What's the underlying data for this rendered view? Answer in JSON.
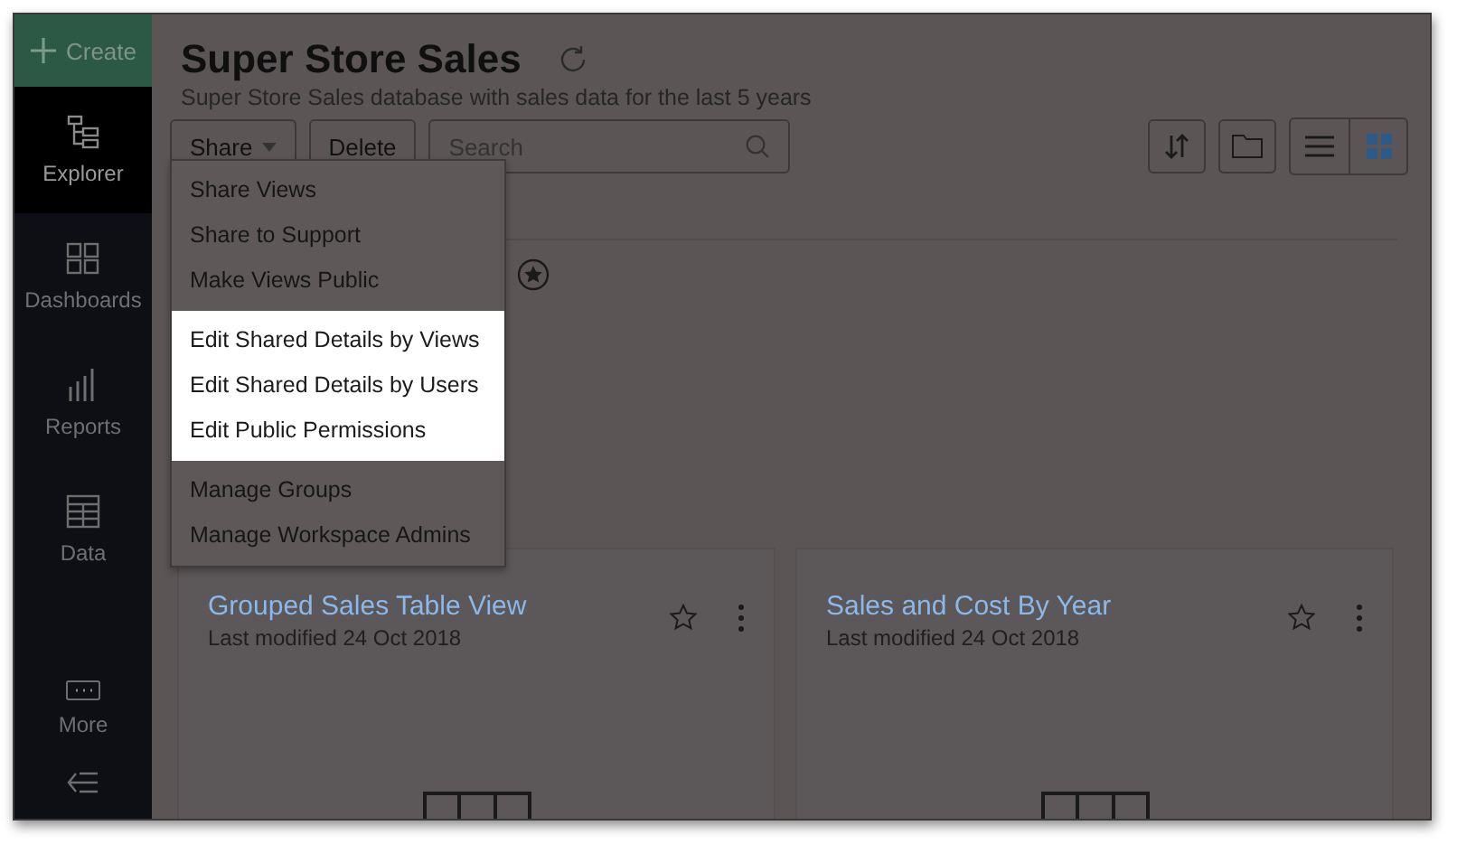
{
  "sidebar": {
    "create_label": "Create",
    "items": [
      {
        "label": "Explorer",
        "selected": true
      },
      {
        "label": "Dashboards",
        "selected": false
      },
      {
        "label": "Reports",
        "selected": false
      },
      {
        "label": "Data",
        "selected": false
      },
      {
        "label": "More",
        "selected": false
      }
    ]
  },
  "header": {
    "title": "Super Store Sales",
    "subtitle": "Super Store Sales database with sales data for the last 5 years"
  },
  "toolbar": {
    "share_label": "Share",
    "delete_label": "Delete",
    "search": {
      "placeholder": "Search"
    },
    "view_buttons": [
      {
        "selected": false
      },
      {
        "selected": true
      }
    ]
  },
  "share_menu": {
    "items": [
      {
        "label": "Share Views",
        "highlighted": false
      },
      {
        "label": "Share to Support",
        "highlighted": false
      },
      {
        "label": "Make Views Public",
        "highlighted": false
      },
      {
        "label": "Edit Shared Details by Views",
        "highlighted": true
      },
      {
        "label": "Edit Shared Details by Users",
        "highlighted": true
      },
      {
        "label": "Edit Public Permissions",
        "highlighted": true
      },
      {
        "label": "Manage Groups",
        "highlighted": false
      },
      {
        "label": "Manage Workspace Admins",
        "highlighted": false
      }
    ]
  },
  "cards": [
    {
      "title": "Grouped Sales Table View",
      "modified": "Last modified 24 Oct 2018",
      "favorite": false
    },
    {
      "title": "Sales and Cost By Year",
      "modified": "Last modified 24 Oct 2018",
      "favorite": false
    }
  ]
}
